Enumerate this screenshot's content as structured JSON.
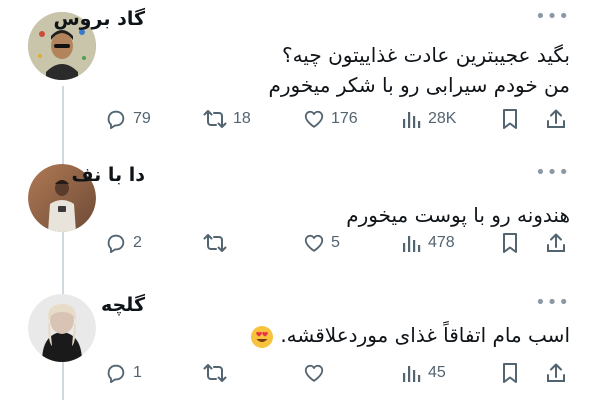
{
  "tweets": [
    {
      "author": "گاد بروس",
      "more": "•••",
      "lines": [
        "بگید عجیبترین عادت غذاییتون چیه؟",
        "من خودم سیرابی رو با شکر میخورم"
      ],
      "replies": "79",
      "retweets": "18",
      "likes": "176",
      "views": "28K"
    },
    {
      "author": "دا با نف",
      "more": "•••",
      "lines": [
        "هندونه رو با پوست میخورم"
      ],
      "replies": "2",
      "retweets": "",
      "likes": "5",
      "views": "478"
    },
    {
      "author": "گلچه",
      "more": "•••",
      "lines": [
        "اسب مام اتفاقاً غذای موردعلاقشه."
      ],
      "replies": "1",
      "retweets": "",
      "likes": "",
      "views": "45"
    }
  ],
  "icons": {
    "reply": "reply-icon",
    "retweet": "retweet-icon",
    "like": "heart-icon",
    "views": "views-icon",
    "bookmark": "bookmark-icon",
    "share": "share-icon",
    "emoji": "heart-eyes-emoji"
  },
  "colors": {
    "icon_gray": "#536471",
    "text": "#0f1419",
    "thread_line": "#cfd9de"
  }
}
